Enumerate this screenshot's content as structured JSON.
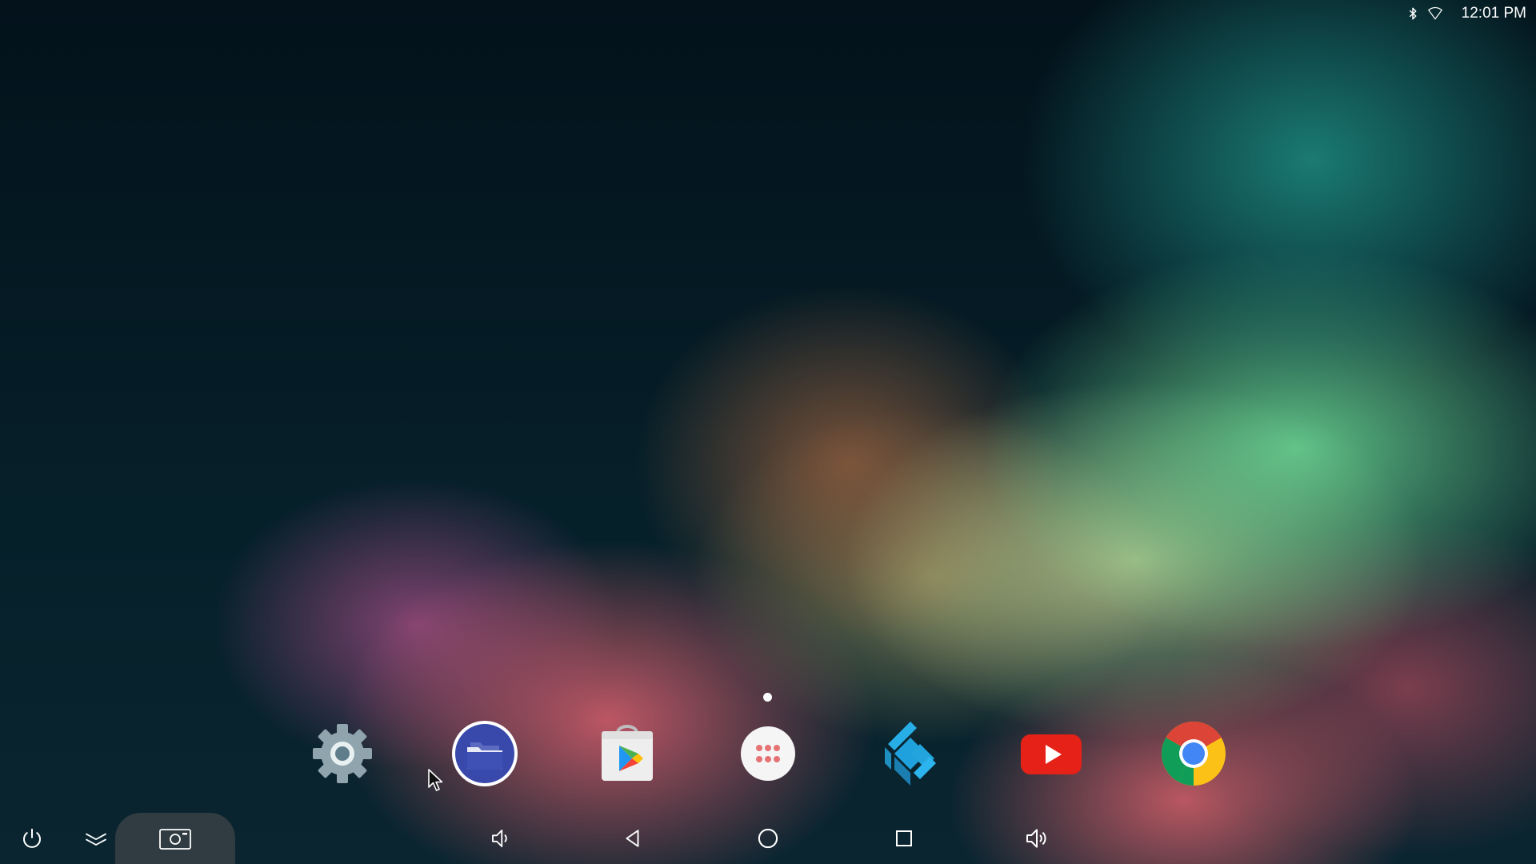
{
  "status_bar": {
    "bluetooth_icon": "bluetooth-icon",
    "wifi_icon": "wifi-icon",
    "time": "12:01 PM"
  },
  "home": {
    "page_indicator": {
      "pages": 1,
      "current": 1
    }
  },
  "dock": {
    "apps": [
      {
        "icon": "settings-icon",
        "color": "#90a4ae"
      },
      {
        "icon": "file-manager-icon",
        "color": "#3949ab"
      },
      {
        "icon": "play-store-icon",
        "color": "#eeeeee"
      },
      {
        "icon": "app-drawer-icon",
        "color": "#ffffff"
      },
      {
        "icon": "kodi-icon",
        "color": "#1ea1dc"
      },
      {
        "icon": "youtube-icon",
        "color": "#e62117"
      },
      {
        "icon": "chrome-icon",
        "color": "#4285f4"
      }
    ]
  },
  "navigation_bar": {
    "buttons": [
      {
        "icon": "power-icon"
      },
      {
        "icon": "collapse-icon"
      },
      {
        "icon": "screenshot-icon"
      },
      {
        "icon": "volume-down-icon"
      },
      {
        "icon": "back-icon"
      },
      {
        "icon": "home-icon"
      },
      {
        "icon": "recents-icon"
      },
      {
        "icon": "volume-up-icon"
      }
    ]
  }
}
